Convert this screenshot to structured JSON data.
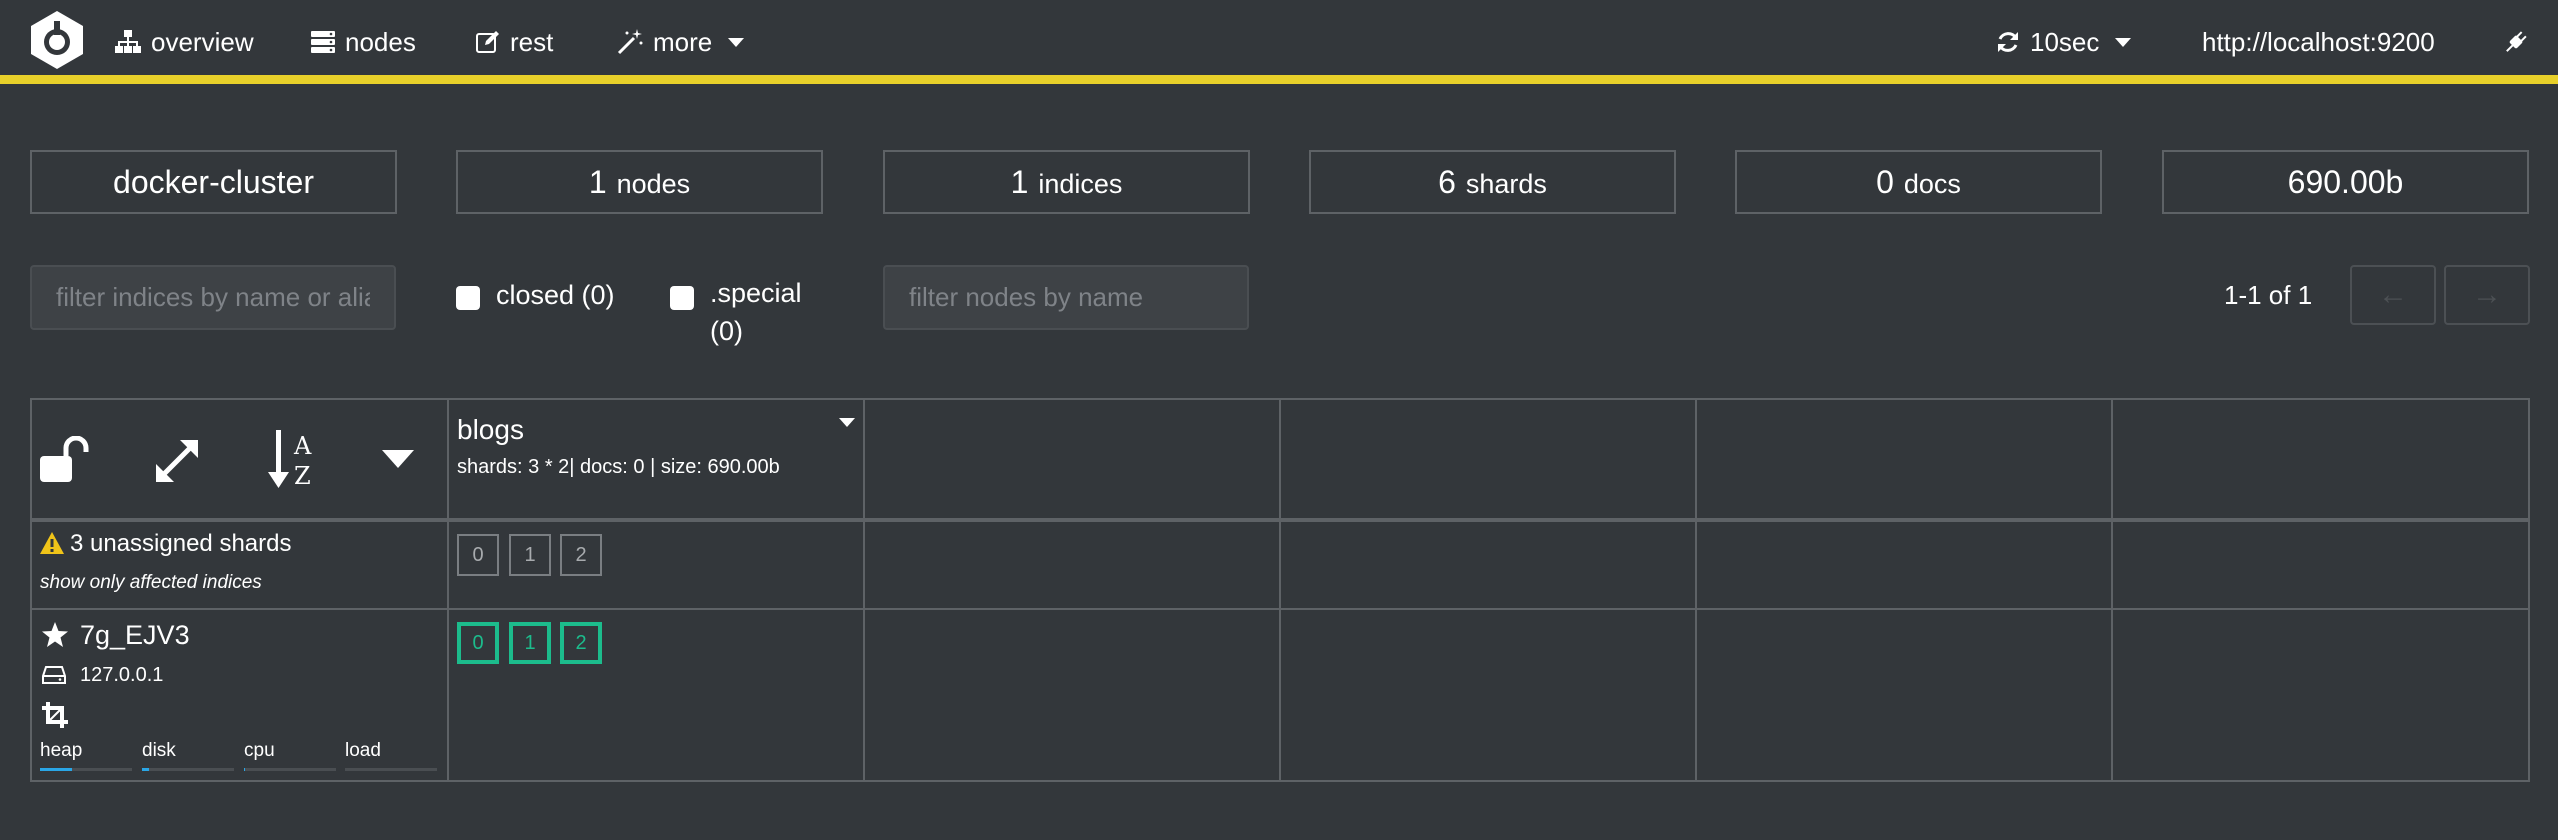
{
  "nav": {
    "overview": "overview",
    "nodes": "nodes",
    "rest": "rest",
    "more": "more",
    "refresh": "10sec",
    "host": "http://localhost:9200"
  },
  "stats": {
    "cluster": "docker-cluster",
    "nodes_num": "1",
    "nodes_unit": "nodes",
    "indices_num": "1",
    "indices_unit": "indices",
    "shards_num": "6",
    "shards_unit": "shards",
    "docs_num": "0",
    "docs_unit": "docs",
    "size": "690.00b"
  },
  "filters": {
    "indices_placeholder": "filter indices by name or aliases",
    "closed_label": "closed (0)",
    "special_label_1": ".special",
    "special_label_2": "(0)",
    "nodes_placeholder": "filter nodes by name"
  },
  "pager": {
    "text": "1-1 of 1",
    "prev": "←",
    "next": "→"
  },
  "index": {
    "name": "blogs",
    "meta": "shards: 3 * 2| docs: 0 | size: 690.00b"
  },
  "unassigned": {
    "label": "3 unassigned shards",
    "link": "show only affected indices",
    "shards": [
      "0",
      "1",
      "2"
    ]
  },
  "node": {
    "name": "7g_EJV3",
    "ip": "127.0.0.1",
    "shards": [
      "0",
      "1",
      "2"
    ],
    "meters": [
      {
        "label": "heap",
        "value": 0.35
      },
      {
        "label": "disk",
        "value": 0.08
      },
      {
        "label": "cpu",
        "value": 0.01
      },
      {
        "label": "load",
        "value": 0.0
      }
    ]
  },
  "colors": {
    "accent_bar": "#e8d02a",
    "shard_started": "#1cbc8c",
    "meter_fill": "#2aa6e6",
    "warning": "#f0c419"
  },
  "icons": {
    "logo": "cerebro-logo-icon",
    "overview": "sitemap-icon",
    "nodes": "server-icon",
    "rest": "edit-icon",
    "more": "magic-wand-icon",
    "refresh": "refresh-icon",
    "connect": "plug-icon"
  }
}
